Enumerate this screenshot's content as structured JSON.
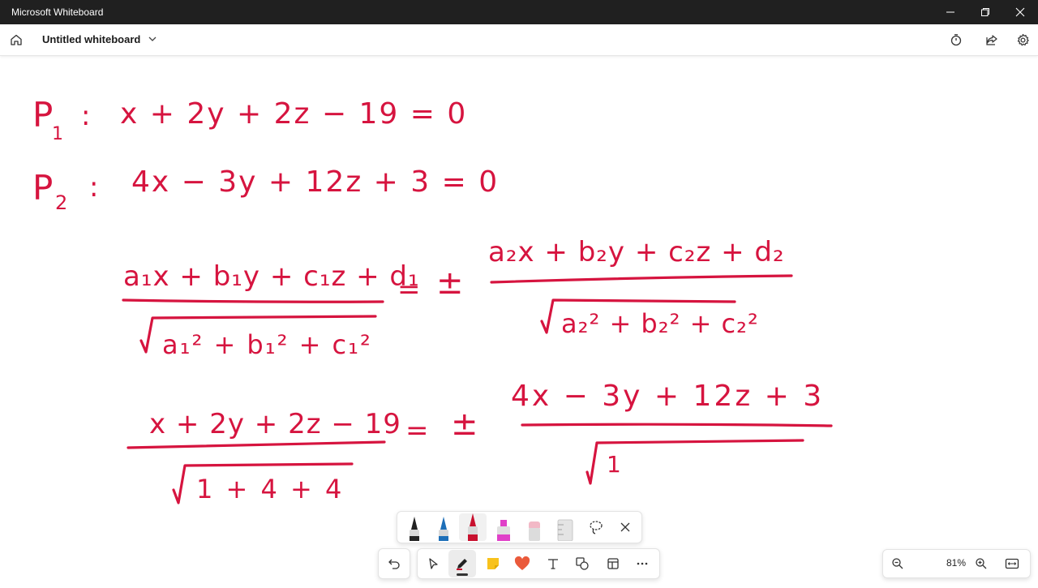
{
  "window": {
    "app_title": "Microsoft Whiteboard",
    "controls": [
      "minimize-icon",
      "restore-icon",
      "close-icon"
    ]
  },
  "header": {
    "doc_title": "Untitled whiteboard",
    "icons": [
      "home-icon",
      "chevron-down-icon",
      "timer-icon",
      "share-icon",
      "gear-icon"
    ]
  },
  "canvas": {
    "ink_color": "#d6143f",
    "lines": {
      "p1_label": "P",
      "p1_sub": "1",
      "p1_colon": ":",
      "p1_eq": "x + 2y + 2z − 19 = 0",
      "p2_label": "P",
      "p2_sub": "2",
      "p2_colon": ":",
      "p2_eq": "4x − 3y + 12z + 3 = 0",
      "gen_num_left": "a₁x + b₁y + c₁z + d₁",
      "gen_den_left": "a₁² + b₁² + c₁²",
      "gen_eq": "=",
      "gen_pm": "±",
      "gen_num_right": "a₂x + b₂y + c₂z + d₂",
      "gen_den_right": "a₂² + b₂² + c₂²",
      "sub_num_left": "x + 2y + 2z − 19",
      "sub_den_left": "1 + 4 + 4",
      "sub_eq": "=",
      "sub_pm": "±",
      "sub_num_right": "4x − 3y + 12z + 3",
      "sub_den_right": "1"
    }
  },
  "pen_tray": {
    "items": [
      "black-pen",
      "blue-pen",
      "red-pen",
      "pink-highlighter",
      "eraser",
      "ruler",
      "lasso-icon",
      "close-icon"
    ],
    "selected": "red-pen",
    "colors": {
      "black": "#222222",
      "blue": "#1e6fb8",
      "red": "#c8102e",
      "pink": "#e040c8"
    }
  },
  "toolbar": {
    "items": [
      "undo-icon",
      "select-icon",
      "pen-icon",
      "sticky-note-icon",
      "reaction-icon",
      "text-icon",
      "shapes-icon",
      "template-icon",
      "more-icon"
    ],
    "selected": "pen-icon"
  },
  "zoom": {
    "value": "81%",
    "icons": [
      "zoom-out-icon",
      "zoom-in-icon",
      "fit-to-screen-icon"
    ]
  }
}
